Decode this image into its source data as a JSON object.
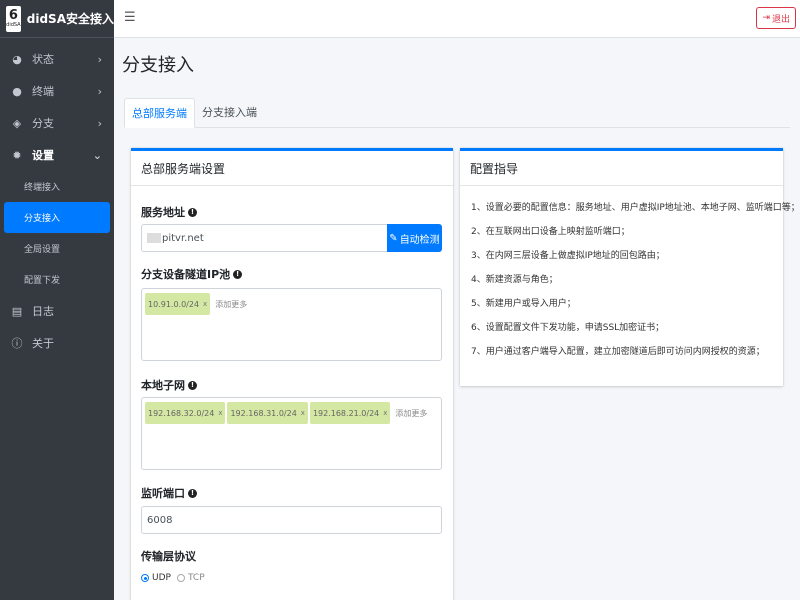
{
  "brand": {
    "logo_number": "6",
    "logo_sub": "didSA",
    "name": "didSA安全接入"
  },
  "sidebar": {
    "items": [
      {
        "label": "状态",
        "icon": "dashboard-icon"
      },
      {
        "label": "终端",
        "icon": "users-icon"
      },
      {
        "label": "分支",
        "icon": "shield-icon"
      },
      {
        "label": "设置",
        "icon": "gear-icon"
      },
      {
        "label": "日志",
        "icon": "log-icon"
      },
      {
        "label": "关于",
        "icon": "info-icon"
      }
    ],
    "settings_sub": [
      "终端接入",
      "分支接入",
      "全局设置",
      "配置下发"
    ]
  },
  "header": {
    "menu_icon": "☰",
    "logout_label": "退出"
  },
  "page": {
    "title": "分支接入"
  },
  "tabs": [
    "总部服务端",
    "分支接入端"
  ],
  "form": {
    "card_title": "总部服务端设置",
    "server_label": "服务地址",
    "server_value": "pitvr.net",
    "detect_label": "自动检测",
    "pool_label": "分支设备隧道IP池",
    "pool_tags": [
      "10.91.0.0/24"
    ],
    "add_more": "添加更多",
    "subnet_label": "本地子网",
    "subnet_tags": [
      "192.168.32.0/24",
      "192.168.31.0/24",
      "192.168.21.0/24"
    ],
    "port_label": "监听端口",
    "port_value": "6008",
    "protocol_label": "传输层协议",
    "protocol_options": [
      "UDP",
      "TCP"
    ],
    "protocol_selected": "UDP"
  },
  "guide": {
    "title": "配置指导",
    "steps": [
      "1、设置必要的配置信息：服务地址、用户虚拟IP地址池、本地子网、监听端口等；",
      "2、在互联网出口设备上映射监听端口；",
      "3、在内网三层设备上做虚拟IP地址的回包路由；",
      "4、新建资源与角色；",
      "5、新建用户或导入用户；",
      "6、设置配置文件下发功能，申请SSL加密证书；",
      "7、用户通过客户端导入配置，建立加密隧道后即可访问内网授权的资源；"
    ]
  },
  "colors": {
    "sidebar_bg": "#343a40",
    "primary": "#007bff",
    "danger": "#dc3545",
    "tag_bg": "#d4e7a3"
  }
}
